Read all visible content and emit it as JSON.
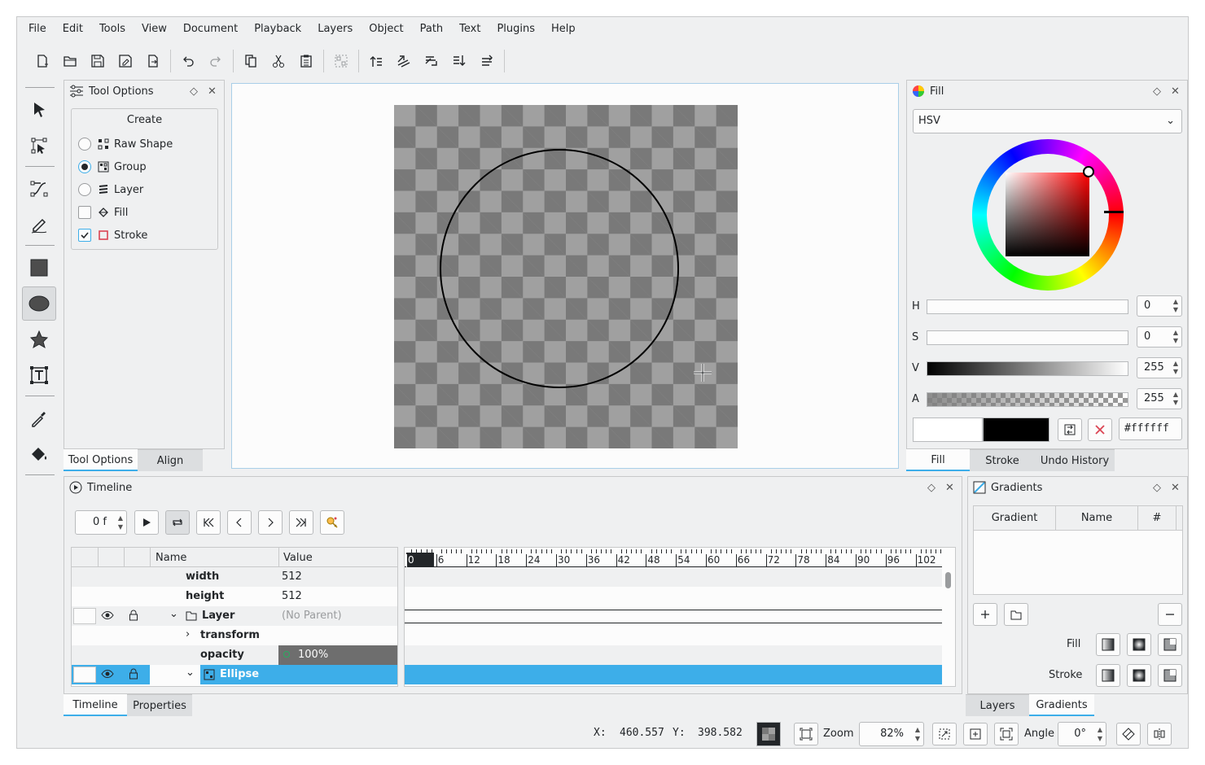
{
  "menu": [
    "File",
    "Edit",
    "Tools",
    "View",
    "Document",
    "Playback",
    "Layers",
    "Object",
    "Path",
    "Text",
    "Plugins",
    "Help"
  ],
  "toolbar": {
    "icons": [
      "new-document-icon",
      "open-icon",
      "save-icon",
      "save-as-icon",
      "export-icon",
      "undo-icon",
      "redo-icon",
      "copy-icon",
      "cut-icon",
      "paste-icon",
      "group-icon",
      "raise-to-top-icon",
      "raise-icon",
      "lower-icon",
      "lower-to-bottom-icon",
      "flip-icon"
    ]
  },
  "tools": [
    "select-arrow-icon",
    "edit-nodes-icon",
    "draw-bezier-icon",
    "freehand-pencil-icon",
    "rectangle-icon",
    "ellipse-icon",
    "star-icon",
    "text-icon",
    "color-picker-icon",
    "fill-bucket-icon"
  ],
  "tool_options": {
    "title": "Tool Options",
    "group_title": "Create",
    "options": [
      {
        "label": "Raw Shape",
        "type": "radio",
        "checked": false
      },
      {
        "label": "Group",
        "type": "radio",
        "checked": true
      },
      {
        "label": "Layer",
        "type": "radio",
        "checked": false
      },
      {
        "label": "Fill",
        "type": "checkbox",
        "checked": false
      },
      {
        "label": "Stroke",
        "type": "checkbox",
        "checked": true
      }
    ],
    "tabs": [
      "Tool Options",
      "Align"
    ]
  },
  "fill": {
    "title": "Fill",
    "mode": "HSV",
    "sliders": [
      {
        "label": "H",
        "value": "0"
      },
      {
        "label": "S",
        "value": "0"
      },
      {
        "label": "V",
        "value": "255"
      },
      {
        "label": "A",
        "value": "255"
      }
    ],
    "hex": "#ffffff",
    "current_color": "#ffffff",
    "secondary_color": "#000000",
    "tabs": [
      "Fill",
      "Stroke",
      "Undo History"
    ]
  },
  "timeline": {
    "title": "Timeline",
    "frame": "0 f",
    "columns": [
      "Name",
      "Value"
    ],
    "rows": [
      {
        "name": "width",
        "value": "512"
      },
      {
        "name": "height",
        "value": "512"
      },
      {
        "name": "Layer",
        "value": "(No Parent)"
      },
      {
        "name": "transform",
        "value": ""
      },
      {
        "name": "opacity",
        "value": "100%"
      },
      {
        "name": "Ellipse",
        "value": ""
      }
    ],
    "ruler": [
      "0",
      "6",
      "12",
      "18",
      "24",
      "30",
      "36",
      "42",
      "48",
      "54",
      "60",
      "66",
      "72",
      "78",
      "84",
      "90",
      "96",
      "102"
    ],
    "tabs": [
      "Timeline",
      "Properties"
    ]
  },
  "gradients": {
    "title": "Gradients",
    "columns": [
      "Gradient",
      "Name",
      "#"
    ],
    "fill_label": "Fill",
    "stroke_label": "Stroke",
    "tabs": [
      "Layers",
      "Gradients"
    ]
  },
  "status": {
    "x_label": "X:",
    "x_value": "460.557",
    "y_label": "Y:",
    "y_value": "398.582",
    "zoom_label": "Zoom",
    "zoom_value": "82%",
    "angle_label": "Angle",
    "angle_value": "0°"
  },
  "colors": {
    "accent": "#3daee9",
    "selection": "#3daee9"
  }
}
